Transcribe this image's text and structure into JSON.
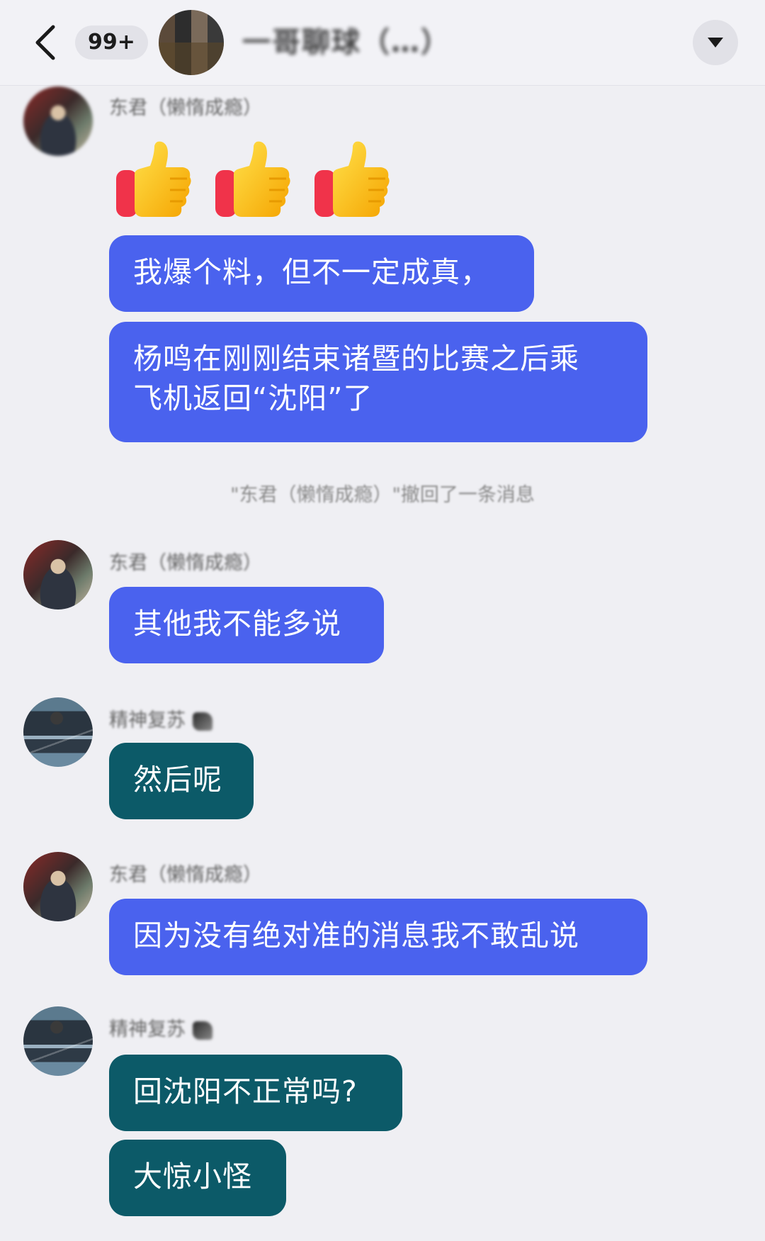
{
  "header": {
    "back_icon": "chevron-left-icon",
    "unread_count": "99+",
    "group_title": "一哥聊球（…）",
    "menu_icon": "triangle-down-icon"
  },
  "colors": {
    "my_bubble": "#4a62ee",
    "other_bubble": "#0c5a68",
    "background": "#efeff3"
  },
  "messages": [
    {
      "sender": "东君（懒惰成瘾）",
      "type": "emoji",
      "content": [
        "👍",
        "👍",
        "👍"
      ]
    },
    {
      "sender": "东君（懒惰成瘾）",
      "type": "text",
      "content": "我爆个料，但不一定成真，"
    },
    {
      "sender": "东君（懒惰成瘾）",
      "type": "text",
      "content_line1": "杨鸣在刚刚结束诸暨的比赛之后乘",
      "content_line2": "飞机返回“沈阳”了"
    },
    {
      "type": "recall",
      "content": "\"东君（懒惰成瘾）\"撤回了一条消息"
    },
    {
      "sender": "东君（懒惰成瘾）",
      "type": "text",
      "content": "其他我不能多说"
    },
    {
      "sender": "精神复苏",
      "type": "text",
      "content": "然后呢"
    },
    {
      "sender": "东君（懒惰成瘾）",
      "type": "text",
      "content": "因为没有绝对准的消息我不敢乱说"
    },
    {
      "sender": "精神复苏",
      "type": "text",
      "content": "回沈阳不正常吗?"
    },
    {
      "sender": "精神复苏",
      "type": "text",
      "content": "大惊小怪"
    }
  ]
}
